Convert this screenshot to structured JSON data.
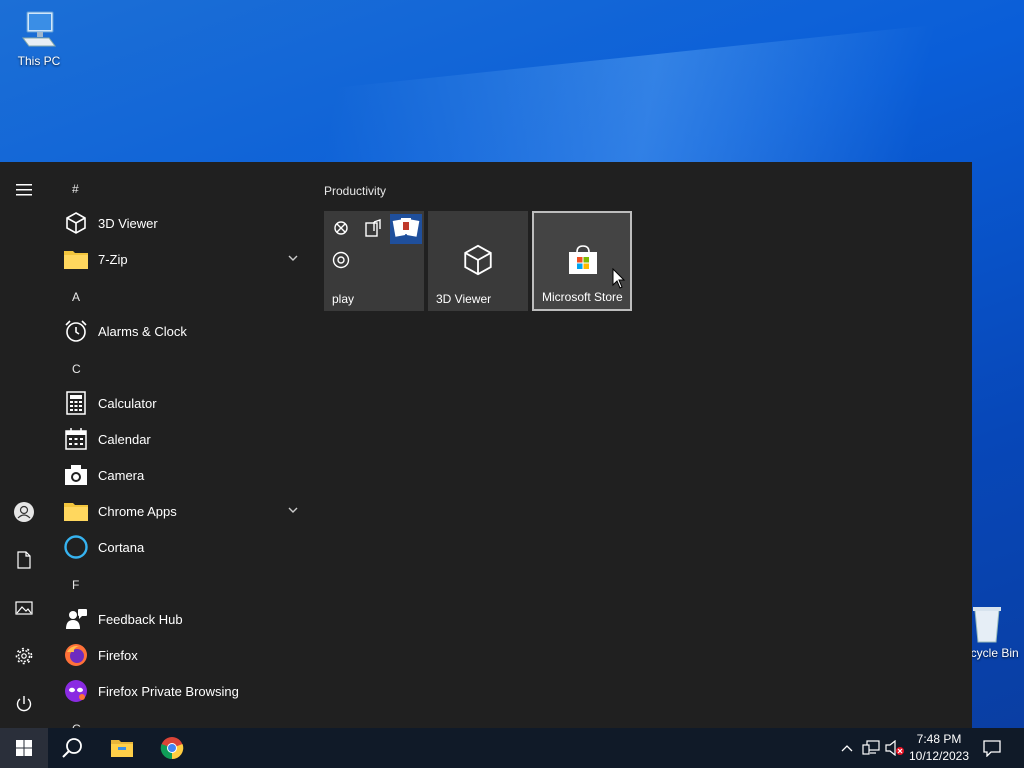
{
  "desktop": {
    "icons": [
      {
        "label": "This PC"
      },
      {
        "label": "Recycle Bin"
      }
    ]
  },
  "start_menu": {
    "rail": {
      "items": [
        "menu-icon",
        "user-icon",
        "documents-icon",
        "pictures-icon",
        "settings-icon",
        "power-icon"
      ]
    },
    "app_list": {
      "groups": [
        {
          "header": "#",
          "items": [
            "3D Viewer",
            "7-Zip"
          ]
        },
        {
          "header": "A",
          "items": [
            "Alarms & Clock"
          ]
        },
        {
          "header": "C",
          "items": [
            "Calculator",
            "Calendar",
            "Camera",
            "Chrome Apps",
            "Cortana"
          ]
        },
        {
          "header": "F",
          "items": [
            "Feedback Hub",
            "Firefox",
            "Firefox Private Browsing"
          ]
        },
        {
          "header": "G",
          "items": []
        }
      ]
    },
    "tiles": {
      "group_title": "Productivity",
      "items": [
        {
          "label": "play"
        },
        {
          "label": "3D Viewer"
        },
        {
          "label": "Microsoft Store",
          "selected": true
        }
      ]
    }
  },
  "taskbar": {
    "pinned": [
      "start-icon",
      "search-icon",
      "file-explorer-icon",
      "chrome-icon"
    ],
    "tray": {
      "time": "7:48 PM",
      "date": "10/12/2023"
    }
  },
  "colors": {
    "menu_bg": "#202020",
    "tile_bg": "#3a3a3a",
    "taskbar_bg": "#101a28",
    "accent": "#0078d7"
  }
}
